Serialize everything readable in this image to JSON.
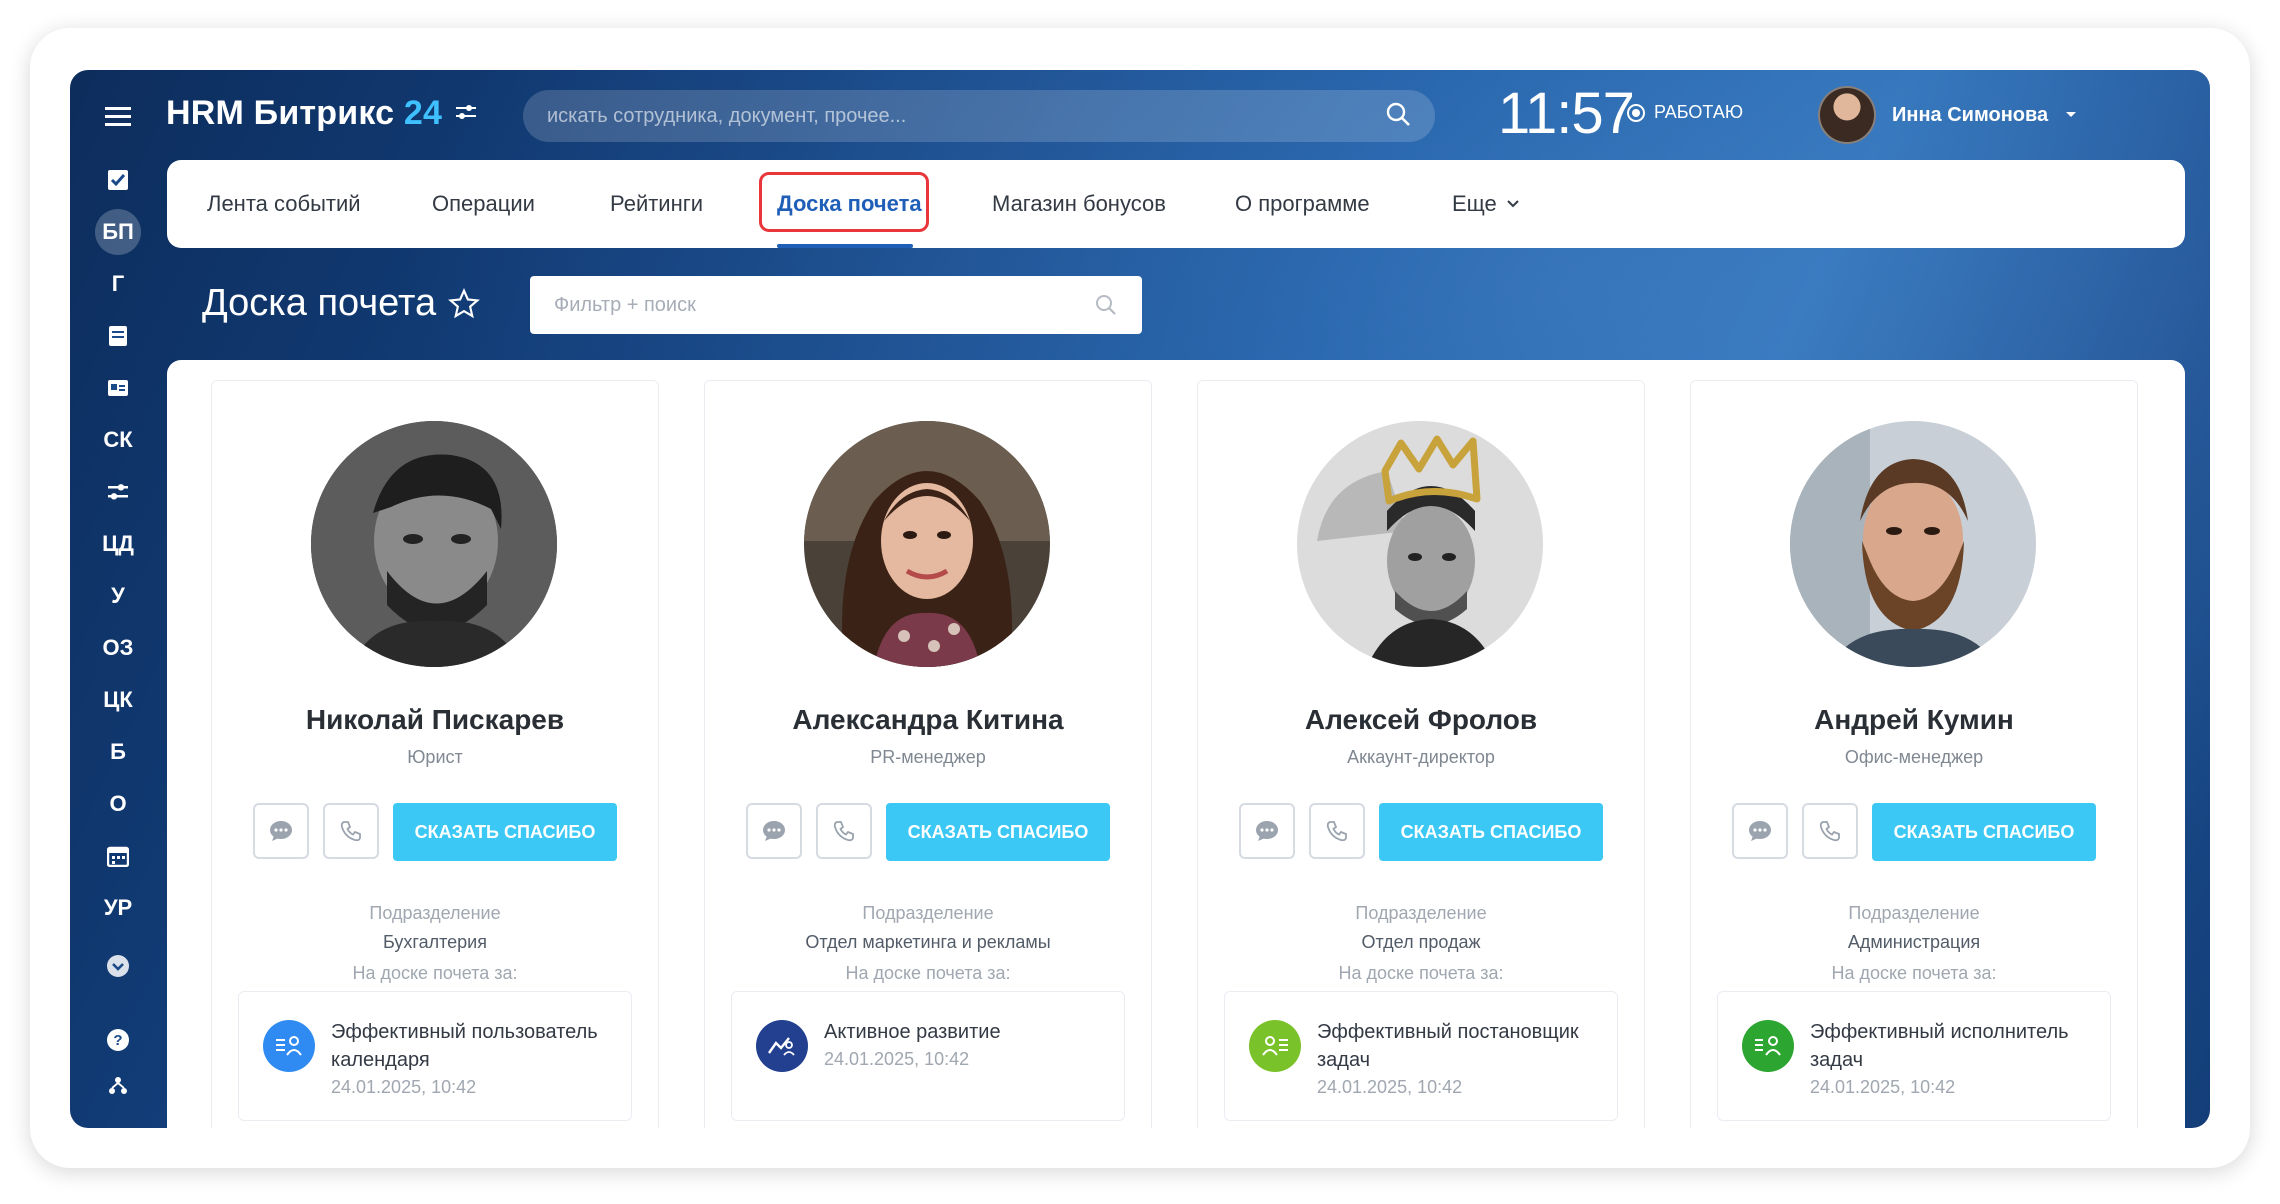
{
  "app": {
    "brand": "HRM Битрикс",
    "brand_num": "24"
  },
  "sidebar": {
    "items": [
      {
        "label": "",
        "icon": "checkbox-icon"
      },
      {
        "label": "БП",
        "active": true
      },
      {
        "label": "Г"
      },
      {
        "label": "",
        "icon": "document-icon"
      },
      {
        "label": "",
        "icon": "id-card-icon"
      },
      {
        "label": "СК"
      },
      {
        "label": "",
        "icon": "sliders-icon"
      },
      {
        "label": "ЦД"
      },
      {
        "label": "У"
      },
      {
        "label": "ОЗ"
      },
      {
        "label": "ЦК"
      },
      {
        "label": "Б"
      },
      {
        "label": "О"
      },
      {
        "label": "",
        "icon": "calendar-icon"
      },
      {
        "label": "УР"
      },
      {
        "label": "",
        "icon": "chevron-down-circle-icon"
      },
      {
        "label": "",
        "icon": "help-icon"
      },
      {
        "label": "",
        "icon": "structure-icon"
      }
    ]
  },
  "header": {
    "search_placeholder": "искать сотрудника, документ, прочее...",
    "time": "11:57",
    "status": "РАБОТАЮ",
    "user_name": "Инна Симонова"
  },
  "tabs": [
    {
      "label": "Лента событий"
    },
    {
      "label": "Операции"
    },
    {
      "label": "Рейтинги"
    },
    {
      "label": "Доска почета",
      "active": true
    },
    {
      "label": "Магазин бонусов"
    },
    {
      "label": "О программе"
    },
    {
      "label": "Еще"
    }
  ],
  "page": {
    "title": "Доска почета",
    "filter_placeholder": "Фильтр + поиск"
  },
  "labels": {
    "thanks_button": "СКАЗАТЬ СПАСИБО",
    "department_label": "Подразделение",
    "board_label": "На доске почета за:"
  },
  "employees": [
    {
      "name": "Николай Пискарев",
      "role": "Юрист",
      "department": "Бухгалтерия",
      "award": "Эффективный пользователь календаря",
      "award_date": "24.01.2025, 10:42",
      "badge_color": "#2f8bf2"
    },
    {
      "name": "Александра Китина",
      "role": "PR-менеджер",
      "department": "Отдел маркетинга и рекламы",
      "award": "Активное развитие",
      "award_date": "24.01.2025, 10:42",
      "badge_color": "#22408f"
    },
    {
      "name": "Алексей Фролов",
      "role": "Аккаунт-директор",
      "department": "Отдел продаж",
      "award": "Эффективный постановщик задач",
      "award_date": "24.01.2025, 10:42",
      "badge_color": "#7ac22a"
    },
    {
      "name": "Андрей Кумин",
      "role": "Офис-менеджер",
      "department": "Администрация",
      "award": "Эффективный исполнитель задач",
      "award_date": "24.01.2025, 10:42",
      "badge_color": "#2ca631"
    }
  ]
}
